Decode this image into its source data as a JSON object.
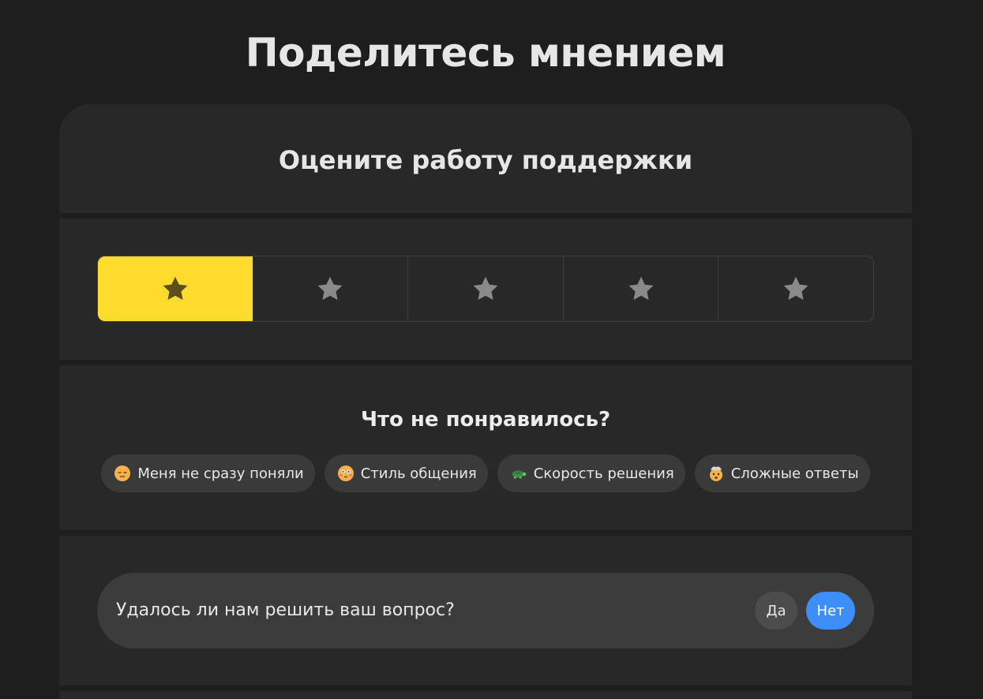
{
  "page": {
    "title": "Поделитесь мнением"
  },
  "header": {
    "title": "Оцените работу поддержки"
  },
  "rating": {
    "value": 1,
    "max": 5,
    "active_color": "#ffdb2e"
  },
  "dislike": {
    "title": "Что не понравилось?",
    "chips": [
      {
        "icon": "pensive-face-icon",
        "label": "Меня не сразу поняли"
      },
      {
        "icon": "flushed-face-icon",
        "label": "Стиль общения"
      },
      {
        "icon": "turtle-icon",
        "label": "Скорость решения"
      },
      {
        "icon": "exploding-head-icon",
        "label": "Сложные ответы"
      }
    ]
  },
  "question": {
    "text": "Удалось ли нам решить ваш вопрос?",
    "yes_label": "Да",
    "no_label": "Нет",
    "selected": "no",
    "accent_color": "#3d8ef8"
  }
}
